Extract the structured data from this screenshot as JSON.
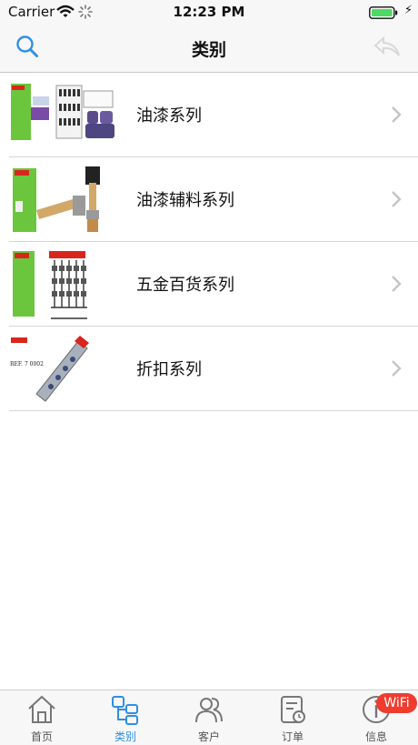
{
  "status_bar": {
    "carrier": "Carrier",
    "time": "12:23 PM"
  },
  "nav": {
    "title": "类别"
  },
  "categories": [
    {
      "label": "油漆系列"
    },
    {
      "label": "油漆辅料系列"
    },
    {
      "label": "五金百货系列"
    },
    {
      "label": "折扣系列",
      "thumb_text": "REF. 7 0002"
    }
  ],
  "tabs": [
    {
      "label": "首页",
      "icon": "home-icon"
    },
    {
      "label": "类别",
      "icon": "category-icon"
    },
    {
      "label": "客户",
      "icon": "customers-icon"
    },
    {
      "label": "订单",
      "icon": "orders-icon"
    },
    {
      "label": "信息",
      "icon": "info-icon"
    }
  ],
  "badge": {
    "wifi_text": "WiFi"
  },
  "colors": {
    "accent": "#2f8fe6",
    "badge": "#f03c2e",
    "bar": "#f7f7f7"
  }
}
